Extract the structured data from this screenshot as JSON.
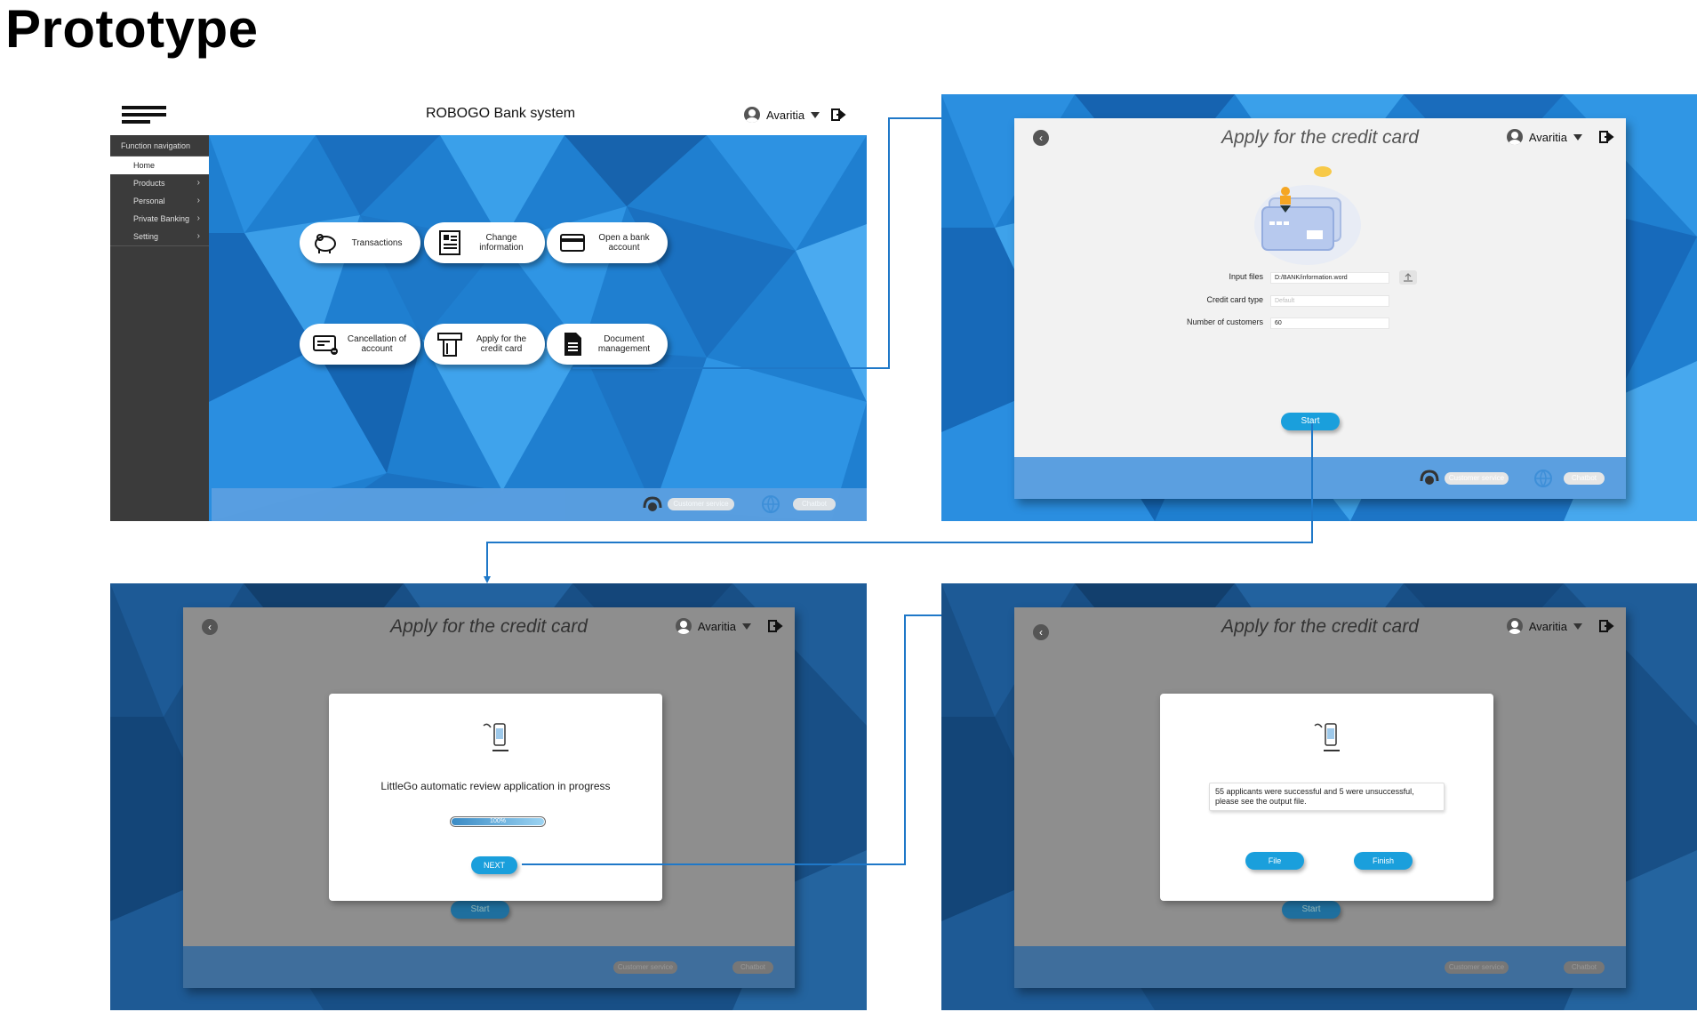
{
  "page": {
    "title": "Prototype"
  },
  "home": {
    "app_title": "ROBOGO Bank system",
    "user": "Avaritia",
    "sidebar": {
      "heading": "Function navigation",
      "items": [
        {
          "label": "Home",
          "active": true,
          "chevron": ""
        },
        {
          "label": "Products",
          "active": false,
          "chevron": "›"
        },
        {
          "label": "Personal",
          "active": false,
          "chevron": "›"
        },
        {
          "label": "Private Banking",
          "active": false,
          "chevron": "›"
        },
        {
          "label": "Setting",
          "active": false,
          "chevron": "›"
        }
      ]
    },
    "tiles": [
      {
        "label": "Transactions",
        "icon": "piggy-bank-icon"
      },
      {
        "label": "Change\ninformation",
        "icon": "id-card-icon"
      },
      {
        "label": "Open a bank\naccount",
        "icon": "bank-card-icon"
      },
      {
        "label": "Cancellation of\naccount",
        "icon": "cancel-card-icon"
      },
      {
        "label": "Apply for the\ncredit card",
        "icon": "atm-card-icon"
      },
      {
        "label": "Document\nmanagement",
        "icon": "document-icon"
      }
    ],
    "footer": {
      "customer_service": "Customer service",
      "chatbot": "Chatbot"
    }
  },
  "apply": {
    "title": "Apply for the credit card",
    "user": "Avaritia",
    "form": {
      "input_files_label": "Input files",
      "input_files_value": "D:/BANK/information.word",
      "card_type_label": "Credit card type",
      "card_type_value": "Default",
      "customers_label": "Number of customers",
      "customers_value": "60"
    },
    "start_label": "Start",
    "footer": {
      "customer_service": "Customer service",
      "chatbot": "Chatbot"
    }
  },
  "review": {
    "title": "Apply for the credit card",
    "user": "Avaritia",
    "message": "LittleGo automatic review application in progress",
    "progress_label": "100%",
    "progress": 1.0,
    "next_label": "NEXT",
    "start_label": "Start",
    "footer": {
      "customer_service": "Customer service",
      "chatbot": "Chatbot"
    }
  },
  "result": {
    "title": "Apply for the credit card",
    "user": "Avaritia",
    "message": "55 applicants were successful and 5 were unsuccessful, please see the output file.",
    "file_label": "File",
    "finish_label": "Finish",
    "start_label": "Start",
    "footer": {
      "customer_service": "Customer service",
      "chatbot": "Chatbot"
    }
  },
  "colors": {
    "accent": "#1a9fdc",
    "footer": "#5b9fe0",
    "sidebar": "#3b3b3b",
    "connector": "#1f78c8"
  }
}
